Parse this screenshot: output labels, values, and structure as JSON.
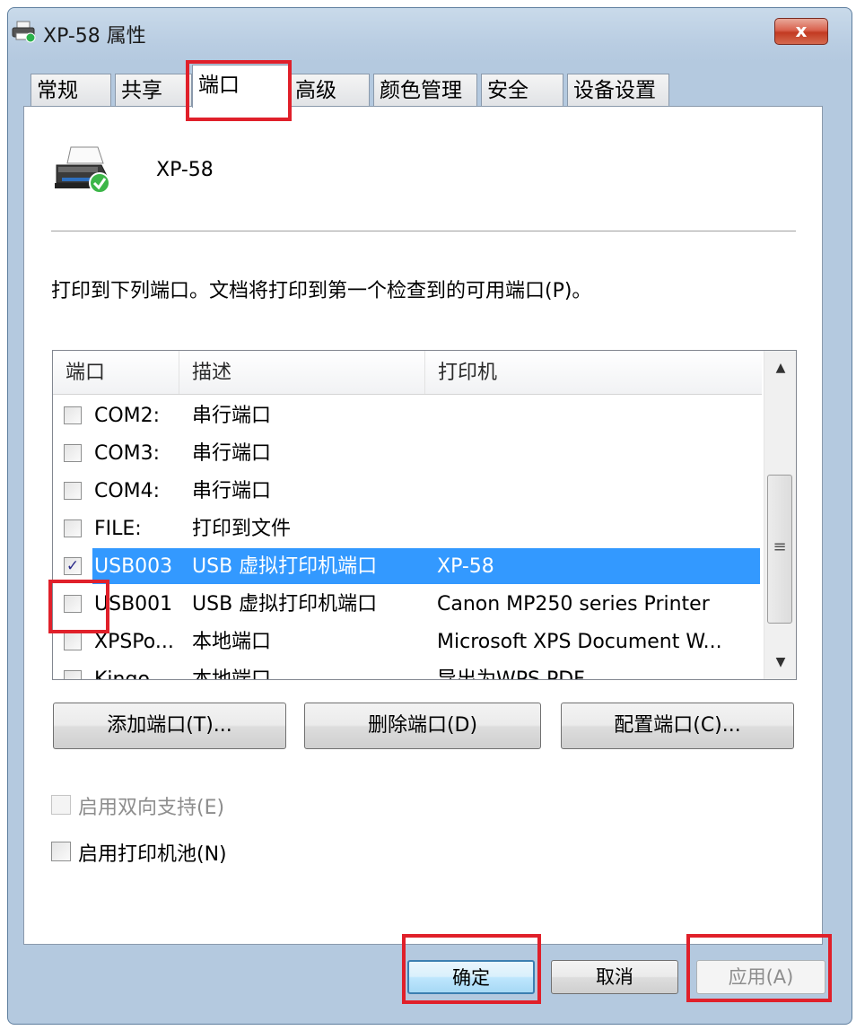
{
  "window": {
    "title": "XP-58 属性",
    "close_label": "x"
  },
  "tabs": [
    {
      "label": "常规"
    },
    {
      "label": "共享"
    },
    {
      "label": "端口"
    },
    {
      "label": "高级"
    },
    {
      "label": "颜色管理"
    },
    {
      "label": "安全"
    },
    {
      "label": "设备设置"
    }
  ],
  "active_tab": "端口",
  "printer": {
    "name": "XP-58",
    "icon": "printer-ready-icon"
  },
  "instruction": "打印到下列端口。文档将打印到第一个检查到的可用端口(P)。",
  "port_list": {
    "columns": [
      "端口",
      "描述",
      "打印机"
    ],
    "rows": [
      {
        "port": "COM2:",
        "description": "串行端口",
        "printer": "",
        "checked": false,
        "selected": false
      },
      {
        "port": "COM3:",
        "description": "串行端口",
        "printer": "",
        "checked": false,
        "selected": false
      },
      {
        "port": "COM4:",
        "description": "串行端口",
        "printer": "",
        "checked": false,
        "selected": false
      },
      {
        "port": "FILE:",
        "description": "打印到文件",
        "printer": "",
        "checked": false,
        "selected": false
      },
      {
        "port": "USB003",
        "description": "USB 虚拟打印机端口",
        "printer": "XP-58",
        "checked": true,
        "selected": true
      },
      {
        "port": "USB001",
        "description": "USB 虚拟打印机端口",
        "printer": "Canon MP250 series Printer",
        "checked": false,
        "selected": false
      },
      {
        "port": "XPSPo...",
        "description": "本地端口",
        "printer": "Microsoft XPS Document W...",
        "checked": false,
        "selected": false
      },
      {
        "port": "Kingo...",
        "description": "本地端口",
        "printer": "导出为WPS PDF",
        "checked": false,
        "selected": false
      }
    ]
  },
  "port_buttons": {
    "add": "添加端口(T)...",
    "delete": "删除端口(D)",
    "configure": "配置端口(C)..."
  },
  "options": {
    "bidirectional": {
      "label": "启用双向支持(E)",
      "checked": false,
      "enabled": false
    },
    "pooling": {
      "label": "启用打印机池(N)",
      "checked": false,
      "enabled": true
    }
  },
  "dialog_buttons": {
    "ok": "确定",
    "cancel": "取消",
    "apply": "应用(A)"
  },
  "colors": {
    "highlight": "#e0202a",
    "selection": "#3399ff"
  }
}
